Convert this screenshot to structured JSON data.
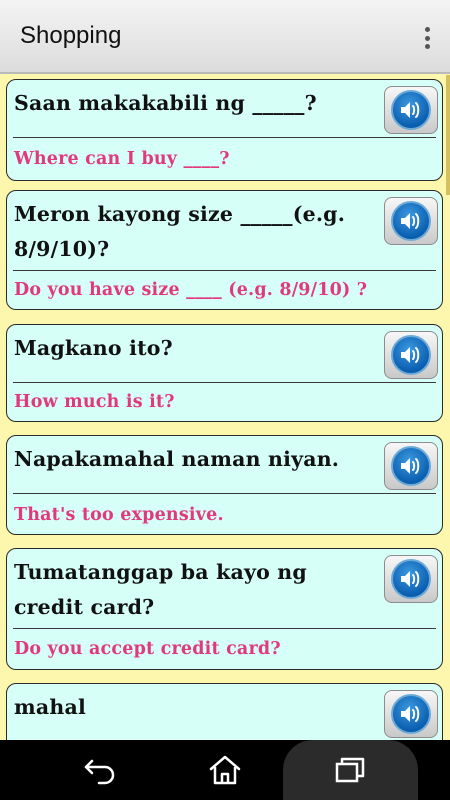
{
  "header": {
    "title": "Shopping",
    "menu_icon": "overflow-menu-icon"
  },
  "phrases": [
    {
      "phrase": "Saan makakabili ng _____?",
      "translation": "Where can I buy ____?",
      "icon": "speaker-icon"
    },
    {
      "phrase": "Meron kayong size _____(e.g. 8/9/10)?",
      "translation": "Do you have size ____ (e.g. 8/9/10) ?",
      "icon": "speaker-icon"
    },
    {
      "phrase": "Magkano ito?",
      "translation": "How much is it?",
      "icon": "speaker-icon"
    },
    {
      "phrase": "Napakamahal naman niyan.",
      "translation": "That's too expensive.",
      "icon": "speaker-icon"
    },
    {
      "phrase": "Tumatanggap ba kayo ng credit card?",
      "translation": "Do you accept credit card?",
      "icon": "speaker-icon"
    },
    {
      "phrase": "mahal",
      "translation": "",
      "icon": "speaker-icon"
    }
  ],
  "nav": {
    "back": "back-icon",
    "home": "home-icon",
    "recents": "recents-icon"
  },
  "colors": {
    "background": "#fdf7ae",
    "card": "#d5fff7",
    "translation_text": "#e2397b",
    "speaker_blue": "#0a5fb0"
  }
}
